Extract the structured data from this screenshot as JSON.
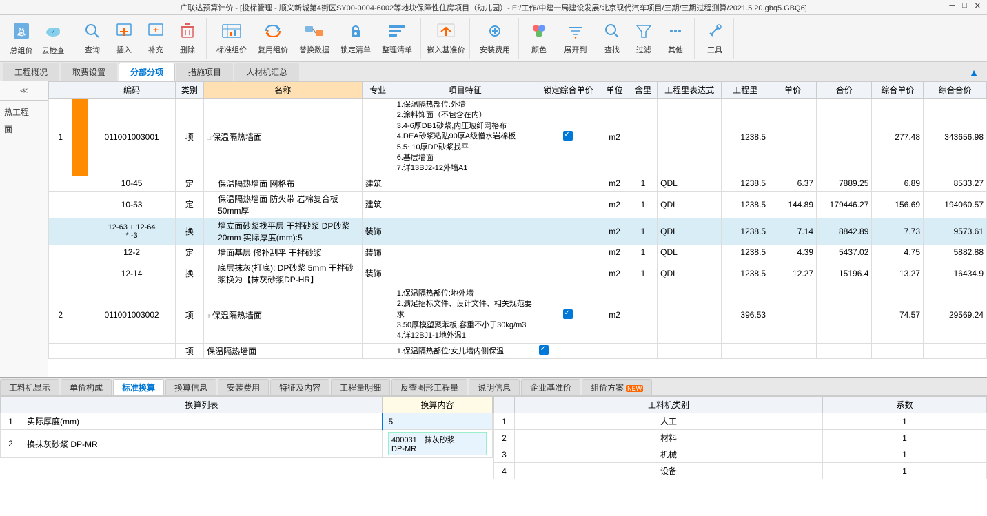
{
  "titlebar": {
    "text": "广联达预算计价 - [投标管理 - 顺义新城第4街区SY00-0004-6002等地块保障性住房项目（幼儿园）- E:/工作/中建一局建设发展/北京现代汽车项目/三期/三期过程测算/2021.5.20.gbq5.GBQ6]"
  },
  "toolbar": {
    "groups": [
      {
        "buttons": [
          {
            "label": "总组价",
            "icon": "📋"
          },
          {
            "label": "云检查",
            "icon": "☁"
          }
        ]
      },
      {
        "buttons": [
          {
            "label": "查询",
            "icon": "🔍"
          },
          {
            "label": "插入",
            "icon": "📄"
          },
          {
            "label": "补充",
            "icon": "➕"
          },
          {
            "label": "删除",
            "icon": "🗑"
          }
        ]
      },
      {
        "buttons": [
          {
            "label": "标准组价",
            "icon": "📊"
          },
          {
            "label": "复用组价",
            "icon": "🔄"
          },
          {
            "label": "替换数据",
            "icon": "🔀"
          },
          {
            "label": "锁定清单",
            "icon": "🔒"
          },
          {
            "label": "整理清单",
            "icon": "📋"
          }
        ]
      },
      {
        "buttons": [
          {
            "label": "嵌入基准价",
            "icon": "📌"
          }
        ]
      },
      {
        "buttons": [
          {
            "label": "安装费用",
            "icon": "🔧"
          }
        ]
      },
      {
        "buttons": [
          {
            "label": "颜色",
            "icon": "🎨"
          },
          {
            "label": "展开到",
            "icon": "⬇"
          },
          {
            "label": "查找",
            "icon": "🔍"
          },
          {
            "label": "过滤",
            "icon": "🔽"
          },
          {
            "label": "其他",
            "icon": "⚙"
          }
        ]
      },
      {
        "buttons": [
          {
            "label": "工具",
            "icon": "🛠"
          }
        ]
      }
    ]
  },
  "tabs": {
    "items": [
      {
        "label": "工程概况",
        "active": false
      },
      {
        "label": "取费设置",
        "active": false
      },
      {
        "label": "分部分项",
        "active": true
      },
      {
        "label": "措施项目",
        "active": false
      },
      {
        "label": "人材机汇总",
        "active": false
      }
    ]
  },
  "table": {
    "headers": [
      "",
      "编码",
      "类别",
      "名称",
      "专业",
      "项目特征",
      "锁定综合单价",
      "单位",
      "含里",
      "工程里表达式",
      "工程里",
      "单价",
      "合价",
      "综合单价",
      "综合合价"
    ],
    "rows": [
      {
        "type": "main",
        "num": "1",
        "code": "011001003001",
        "kind": "项",
        "name": "保温隔热墙面",
        "spec": "1.保温隔热部位:外墙\n2.涂料饰面（不包含在内）\n3.4-6厚DB1砂浆,内压玻纤网格布\n4.DEA砂浆粘贴90厚A级憎水岩棉板\n5.5~10厚DP砂浆找平\n6.基层墙面\n7.详13BJ2-12外墙A1",
        "locked": true,
        "unit": "m2",
        "content": "",
        "expr": "",
        "qty": "1238.5",
        "price": "",
        "total": "",
        "unit_price": "277.48",
        "total_price": "343656.98",
        "expand": true
      },
      {
        "type": "sub",
        "num": "",
        "code": "10-45",
        "kind": "定",
        "name": "保温隔热墙面 网格布",
        "spec": "建筑",
        "locked": false,
        "unit": "m2",
        "content": "1",
        "expr": "QDL",
        "qty": "1238.5",
        "price": "6.37",
        "total": "7889.25",
        "unit_price": "6.89",
        "total_price": "8533.27"
      },
      {
        "type": "sub",
        "num": "",
        "code": "10-53",
        "kind": "定",
        "name": "保温隔热墙面 防火带 岩棉复合板 50mm厚",
        "spec": "建筑",
        "locked": false,
        "unit": "m2",
        "content": "1",
        "expr": "QDL",
        "qty": "1238.5",
        "price": "144.89",
        "total": "179446.27",
        "unit_price": "156.69",
        "total_price": "194060.57"
      },
      {
        "type": "sub-selected",
        "num": "",
        "code": "12-63 + 12-64\n* -3",
        "kind": "换",
        "name": "墙立面砂浆找平层 干拌砂浆 DP砂浆20mm 实际厚度(mm):5",
        "spec": "装饰",
        "locked": false,
        "unit": "m2",
        "content": "1",
        "expr": "QDL",
        "qty": "1238.5",
        "price": "7.14",
        "total": "8842.89",
        "unit_price": "7.73",
        "total_price": "9573.61"
      },
      {
        "type": "sub",
        "num": "",
        "code": "12-2",
        "kind": "定",
        "name": "墙面基层 修补刮平 干拌砂浆",
        "spec": "装饰",
        "locked": false,
        "unit": "m2",
        "content": "1",
        "expr": "QDL",
        "qty": "1238.5",
        "price": "4.39",
        "total": "5437.02",
        "unit_price": "4.75",
        "total_price": "5882.88"
      },
      {
        "type": "sub",
        "num": "",
        "code": "12-14",
        "kind": "换",
        "name": "底层抹灰(打底): DP砂浆 5mm 干拌砂浆换为【抹灰砂浆DP-HR】",
        "spec": "装饰",
        "locked": false,
        "unit": "m2",
        "content": "1",
        "expr": "QDL",
        "qty": "1238.5",
        "price": "12.27",
        "total": "15196.4",
        "unit_price": "13.27",
        "total_price": "16434.9"
      },
      {
        "type": "main",
        "num": "2",
        "code": "011001003002",
        "kind": "项",
        "name": "保温隔热墙面",
        "spec": "1.保温隔热部位:地外墙\n2.满足招标文件、设计文件、相关规范要求\n3.50厚模塑聚苯板,容重不小于30kg/m3\n4.详12BJ1-1地外温1",
        "locked": true,
        "unit": "m2",
        "content": "",
        "expr": "",
        "qty": "396.53",
        "price": "",
        "total": "",
        "unit_price": "74.57",
        "total_price": "29569.24",
        "expand": false
      },
      {
        "type": "main",
        "num": "",
        "code": "",
        "kind": "项",
        "name": "保温隔热墙面",
        "spec": "1.保温隔热部位:女儿墙内侧保温...",
        "locked": true,
        "unit": "",
        "content": "",
        "expr": "",
        "qty": "",
        "price": "",
        "total": "",
        "unit_price": "",
        "total_price": ""
      }
    ]
  },
  "bottom_tabs": {
    "items": [
      {
        "label": "工料机显示",
        "active": false
      },
      {
        "label": "单价构成",
        "active": false
      },
      {
        "label": "标准换算",
        "active": true
      },
      {
        "label": "换算信息",
        "active": false
      },
      {
        "label": "安装费用",
        "active": false
      },
      {
        "label": "特征及内容",
        "active": false
      },
      {
        "label": "工程量明细",
        "active": false
      },
      {
        "label": "反查图形工程量",
        "active": false
      },
      {
        "label": "说明信息",
        "active": false
      },
      {
        "label": "企业基准价",
        "active": false
      },
      {
        "label": "组价方案",
        "active": false,
        "new_badge": true
      }
    ]
  },
  "bottom_left": {
    "headers": [
      "换算列表",
      "换算内容"
    ],
    "rows": [
      {
        "num": "1",
        "name": "实际厚度(mm)",
        "value": "5"
      },
      {
        "num": "2",
        "name": "换抹灰砂浆 DP-MR",
        "value": "400031  抹灰砂浆\nDP-MR"
      }
    ]
  },
  "bottom_right": {
    "headers": [
      "工料机类别",
      "系数"
    ],
    "rows": [
      {
        "num": "1",
        "type": "人工",
        "coef": "1"
      },
      {
        "num": "2",
        "type": "材料",
        "coef": "1"
      },
      {
        "num": "3",
        "type": "机械",
        "coef": "1"
      },
      {
        "num": "4",
        "type": "设备",
        "coef": "1"
      }
    ]
  },
  "sidebar": {
    "collapse_label": "<<",
    "left_items": [
      {
        "label": "热工程"
      },
      {
        "label": "面"
      }
    ]
  }
}
